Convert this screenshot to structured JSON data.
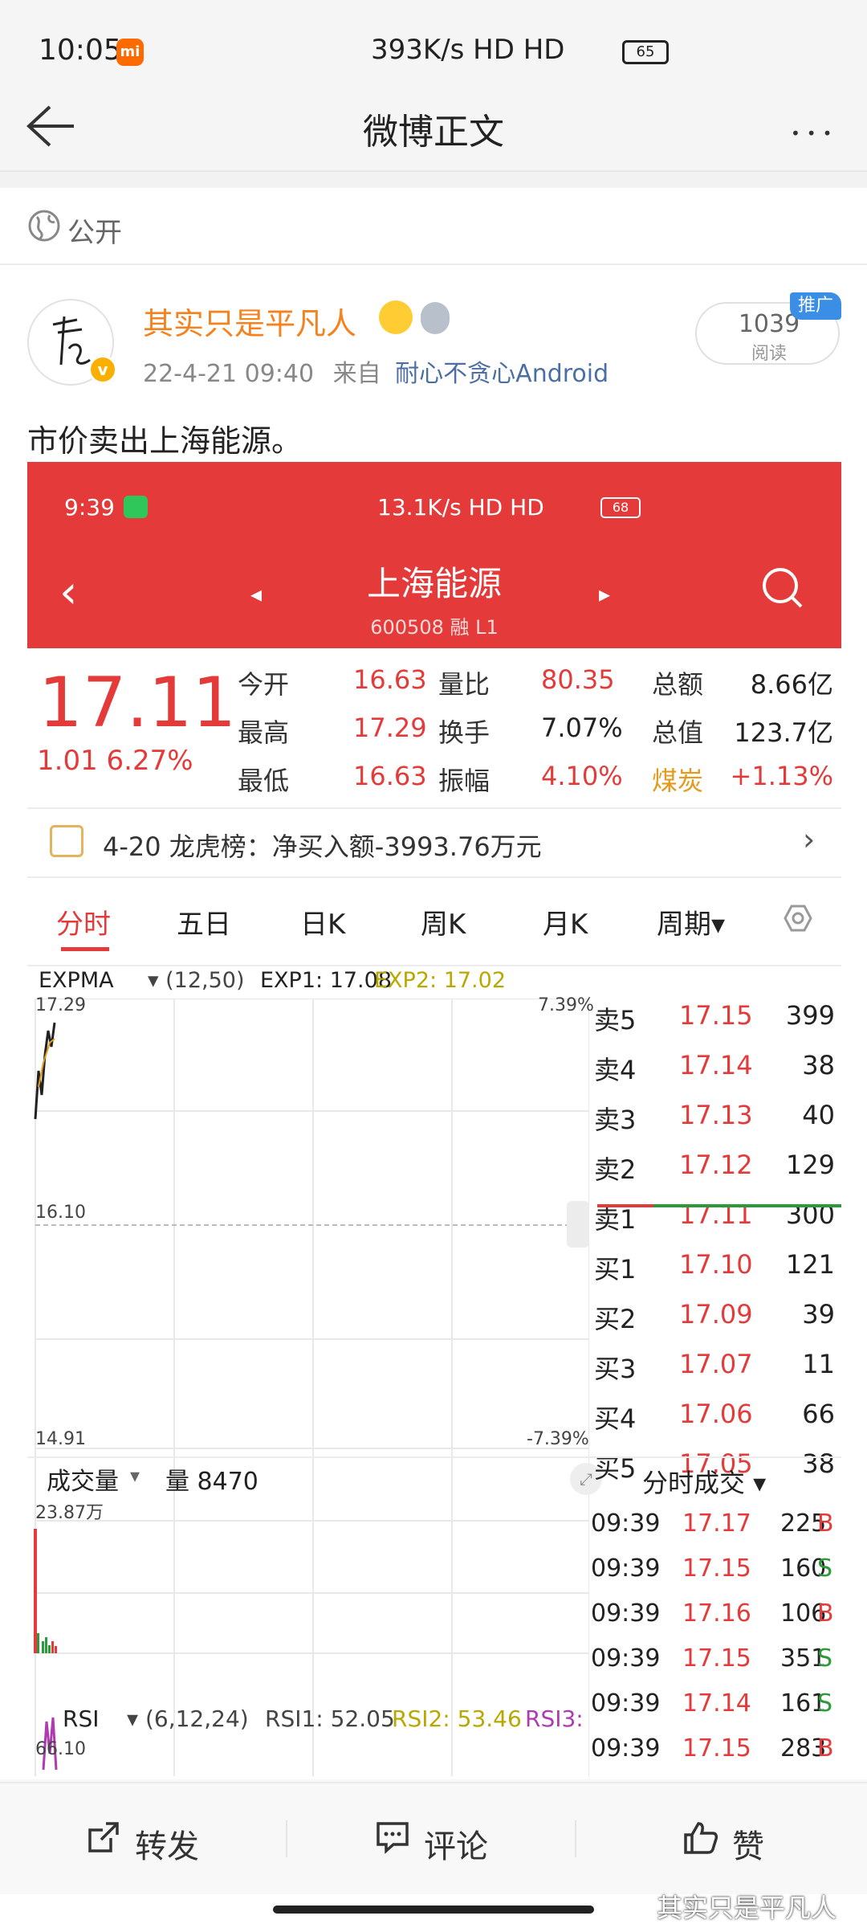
{
  "status_bar": {
    "time": "10:05",
    "mi_badge": "mi",
    "network": "393K/s HD HD",
    "battery": "65"
  },
  "title_bar": {
    "title": "微博正文",
    "more": "•••"
  },
  "visibility": {
    "label": "公开"
  },
  "post": {
    "username": "其实只是平凡人",
    "verify_mark": "v",
    "time": "22-4-21 09:40",
    "source_prefix": "来自",
    "source": "耐心不贪心Android",
    "reads_count": "1039",
    "reads_label": "阅读",
    "promo_tag": "推广",
    "text": "市价卖出上海能源。"
  },
  "screenshot": {
    "status": {
      "time": "9:39",
      "network": "13.1K/s HD HD",
      "battery": "68"
    },
    "header": {
      "back": "‹",
      "prev": "◂",
      "next": "▸",
      "stock_name": "上海能源",
      "stock_code": "600508 融 L1"
    },
    "price": "17.11",
    "change": "1.01  6.27%",
    "quote_rows": [
      [
        {
          "t": "今开",
          "c": "lbl"
        },
        {
          "t": "16.63",
          "c": "red"
        },
        {
          "t": "量比",
          "c": "lbl"
        },
        {
          "t": "80.35",
          "c": "red"
        },
        {
          "t": "总额",
          "c": "lbl"
        },
        {
          "t": "8.66亿",
          "c": "dark"
        }
      ],
      [
        {
          "t": "最高",
          "c": "lbl"
        },
        {
          "t": "17.29",
          "c": "red"
        },
        {
          "t": "换手",
          "c": "lbl"
        },
        {
          "t": "7.07%",
          "c": "dark"
        },
        {
          "t": "总值",
          "c": "lbl"
        },
        {
          "t": "123.7亿",
          "c": "dark"
        }
      ],
      [
        {
          "t": "最低",
          "c": "lbl"
        },
        {
          "t": "16.63",
          "c": "red"
        },
        {
          "t": "振幅",
          "c": "lbl"
        },
        {
          "t": "4.10%",
          "c": "red"
        },
        {
          "t": "煤炭",
          "c": "amber"
        },
        {
          "t": "+1.13%",
          "c": "red"
        }
      ]
    ],
    "longhubang": {
      "text": "4-20 龙虎榜：净买入额-3993.76万元",
      "arrow": "›"
    },
    "tabs": [
      "分时",
      "五日",
      "日K",
      "周K",
      "月K",
      "周期▾"
    ],
    "expma": {
      "name": "EXPMA",
      "params": "▾ (12,50)",
      "exp1": "EXP1: 17.08",
      "exp2": "EXP2: 17.02"
    },
    "price_axis": {
      "top": "17.29",
      "mid": "16.10",
      "bottom": "14.91",
      "top_pct": "7.39%",
      "bottom_pct": "-7.39%"
    },
    "volume": {
      "name": "成交量",
      "arrow": "▾",
      "value": "量 8470",
      "max": "23.87万"
    },
    "rsi": {
      "name": "RSI",
      "params": "▾ (6,12,24)",
      "rsi1": "RSI1: 52.05",
      "rsi2": "RSI2: 53.46",
      "rsi3": "RSI3:",
      "max": "66.10"
    },
    "order_book": [
      {
        "side": "卖5",
        "price": "17.15",
        "vol": "399"
      },
      {
        "side": "卖4",
        "price": "17.14",
        "vol": "38"
      },
      {
        "side": "卖3",
        "price": "17.13",
        "vol": "40"
      },
      {
        "side": "卖2",
        "price": "17.12",
        "vol": "129"
      },
      {
        "side": "卖1",
        "price": "17.11",
        "vol": "300"
      },
      {
        "side": "买1",
        "price": "17.10",
        "vol": "121"
      },
      {
        "side": "买2",
        "price": "17.09",
        "vol": "39"
      },
      {
        "side": "买3",
        "price": "17.07",
        "vol": "11"
      },
      {
        "side": "买4",
        "price": "17.06",
        "vol": "66"
      },
      {
        "side": "买5",
        "price": "17.05",
        "vol": "38"
      }
    ],
    "trades_title": "分时成交 ▾",
    "trades": [
      {
        "time": "09:39",
        "price": "17.17",
        "vol": "225",
        "flag": "B"
      },
      {
        "time": "09:39",
        "price": "17.15",
        "vol": "160",
        "flag": "S"
      },
      {
        "time": "09:39",
        "price": "17.16",
        "vol": "106",
        "flag": "B"
      },
      {
        "time": "09:39",
        "price": "17.15",
        "vol": "351",
        "flag": "S"
      },
      {
        "time": "09:39",
        "price": "17.14",
        "vol": "161",
        "flag": "S"
      },
      {
        "time": "09:39",
        "price": "17.15",
        "vol": "283",
        "flag": "B"
      }
    ]
  },
  "actions": {
    "repost": "转发",
    "comment": "评论",
    "like": "赞"
  },
  "watermark": "其实只是平凡人",
  "colors": {
    "up_red": "#e53a3a",
    "down_green": "#2a9a3a",
    "username_orange": "#f5821f",
    "link_blue": "#4a6fa5"
  }
}
